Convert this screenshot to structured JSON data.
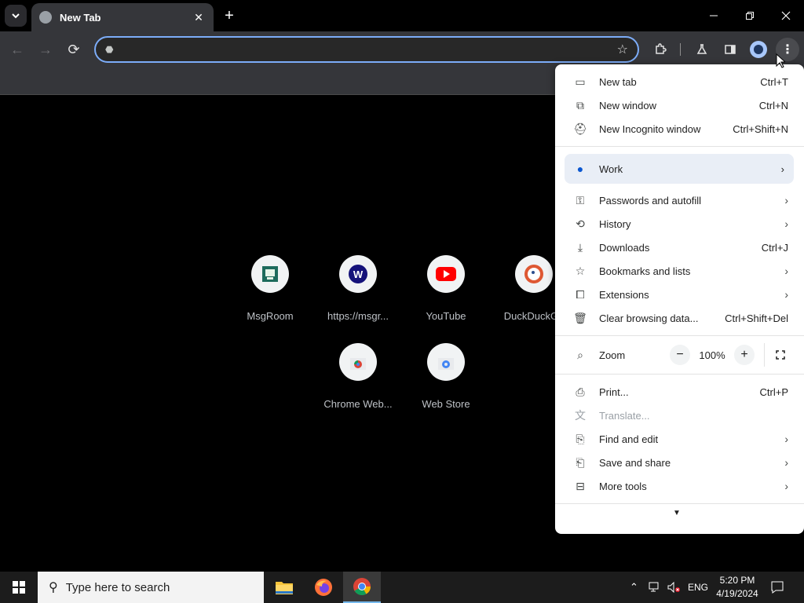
{
  "browser": {
    "tab_title": "New Tab",
    "omnibox_value": "",
    "omnibox_placeholder": ""
  },
  "shortcuts": [
    {
      "label": "MsgRoom",
      "icon": "msgroom-icon"
    },
    {
      "label": "https://msgr...",
      "icon": "w-icon"
    },
    {
      "label": "YouTube",
      "icon": "youtube-icon"
    },
    {
      "label": "DuckDuckGo",
      "icon": "duckduckgo-icon"
    },
    {
      "label": "Chrome Web...",
      "icon": "chrome-web-store-icon"
    },
    {
      "label": "Web Store",
      "icon": "web-store-icon"
    }
  ],
  "menu": {
    "new_tab": {
      "label": "New tab",
      "shortcut": "Ctrl+T"
    },
    "new_window": {
      "label": "New window",
      "shortcut": "Ctrl+N"
    },
    "new_incognito": {
      "label": "New Incognito window",
      "shortcut": "Ctrl+Shift+N"
    },
    "profile": {
      "label": "Work"
    },
    "passwords": {
      "label": "Passwords and autofill"
    },
    "history": {
      "label": "History"
    },
    "downloads": {
      "label": "Downloads",
      "shortcut": "Ctrl+J"
    },
    "bookmarks": {
      "label": "Bookmarks and lists"
    },
    "extensions": {
      "label": "Extensions"
    },
    "clear_data": {
      "label": "Clear browsing data...",
      "shortcut": "Ctrl+Shift+Del"
    },
    "zoom": {
      "label": "Zoom",
      "value": "100%",
      "minus": "−",
      "plus": "+"
    },
    "print": {
      "label": "Print...",
      "shortcut": "Ctrl+P"
    },
    "translate": {
      "label": "Translate..."
    },
    "find_edit": {
      "label": "Find and edit"
    },
    "save_share": {
      "label": "Save and share"
    },
    "more_tools": {
      "label": "More tools"
    }
  },
  "taskbar": {
    "search_placeholder": "Type here to search",
    "language": "ENG",
    "time": "5:20 PM",
    "date": "4/19/2024"
  },
  "colors": {
    "accent": "#7cacf8",
    "toolbar": "#35363a",
    "menu_highlight": "#e9eef6"
  }
}
